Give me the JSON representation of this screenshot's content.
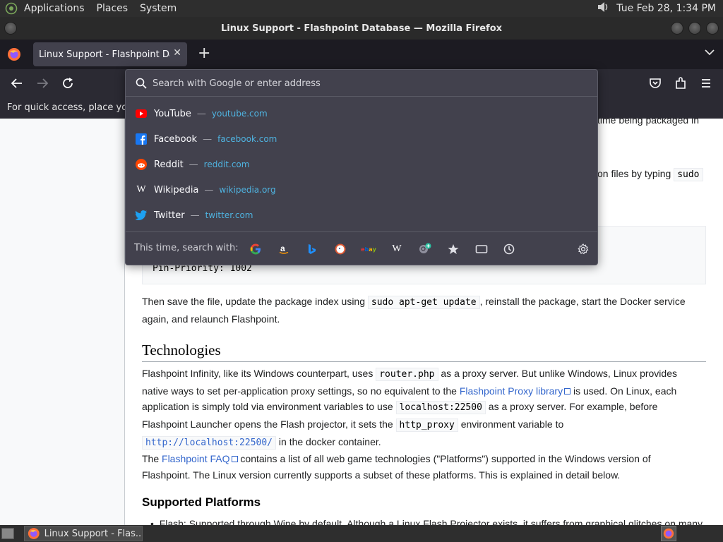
{
  "top_panel": {
    "menus": [
      "Applications",
      "Places",
      "System"
    ],
    "clock": "Tue Feb 28,  1:34 PM"
  },
  "window": {
    "title": "Linux Support - Flashpoint Database — Mozilla Firefox"
  },
  "tab": {
    "title": "Linux Support - Flashpoint Database",
    "close": "✕"
  },
  "bookmarks_bar": {
    "hint": "For quick access, place your"
  },
  "urlbar": {
    "placeholder": "Search with Google or enter address",
    "suggestions": [
      {
        "name": "YouTube",
        "url": "youtube.com",
        "icon": "youtube-icon",
        "color": "#ff0000"
      },
      {
        "name": "Facebook",
        "url": "facebook.com",
        "icon": "facebook-icon",
        "color": "#1877f2"
      },
      {
        "name": "Reddit",
        "url": "reddit.com",
        "icon": "reddit-icon",
        "color": "#ff4500"
      },
      {
        "name": "Wikipedia",
        "url": "wikipedia.org",
        "icon": "wikipedia-icon",
        "color": "#ffffff"
      },
      {
        "name": "Twitter",
        "url": "twitter.com",
        "icon": "twitter-icon",
        "color": "#1da1f2"
      }
    ],
    "separator": "—",
    "search_label": "This time, search with:",
    "engines": [
      "google-icon",
      "amazon-icon",
      "bing-icon",
      "duckduckgo-icon",
      "ebay-icon",
      "wikipedia-engine-icon",
      "add-search-engine-icon",
      "bookmarks-icon",
      "tabs-icon",
      "history-icon",
      "search-settings-icon"
    ]
  },
  "page": {
    "frag_top1": "time being packaged in",
    "frag_top2": "on files by typing",
    "frag_top2_code": "sudo",
    "pre_line": "Pin-Priority: 1002",
    "p1_a": "Then save the file, update the package index using ",
    "p1_code": "sudo apt-get update",
    "p1_b": ", reinstall the package, start the Docker service again, and relaunch Flashpoint.",
    "h2": "Technologies",
    "p2_a": "Flashpoint Infinity, like its Windows counterpart, uses ",
    "p2_code1": "router.php",
    "p2_b": " as a proxy server. But unlike Windows, Linux provides native ways to set per-application proxy settings, so no equivalent to the ",
    "p2_link": "Flashpoint Proxy library",
    "p2_c": " is used. On Linux, each application is simply told via environment variables to use ",
    "p2_code2": "localhost:22500",
    "p2_d": " as a proxy server. For example, before Flashpoint Launcher opens the Flash projector, it sets the ",
    "p2_code3": "http_proxy",
    "p2_e": " environment variable to ",
    "p2_code4": "http://localhost:22500/",
    "p2_f": " in the docker container.",
    "p3_a": "The ",
    "p3_link": "Flashpoint FAQ",
    "p3_b": " contains a list of all web game technologies (\"Platforms\") supported in the Windows version of Flashpoint. The Linux version currently supports a subset of these platforms. This is explained in detail below.",
    "h3": "Supported Platforms",
    "li": "Flash: Supported through Wine by default. Although a Linux Flash Projector exists, it suffers from graphical glitches on many"
  },
  "taskbar": {
    "task_label": "Linux Support - Flas..."
  }
}
